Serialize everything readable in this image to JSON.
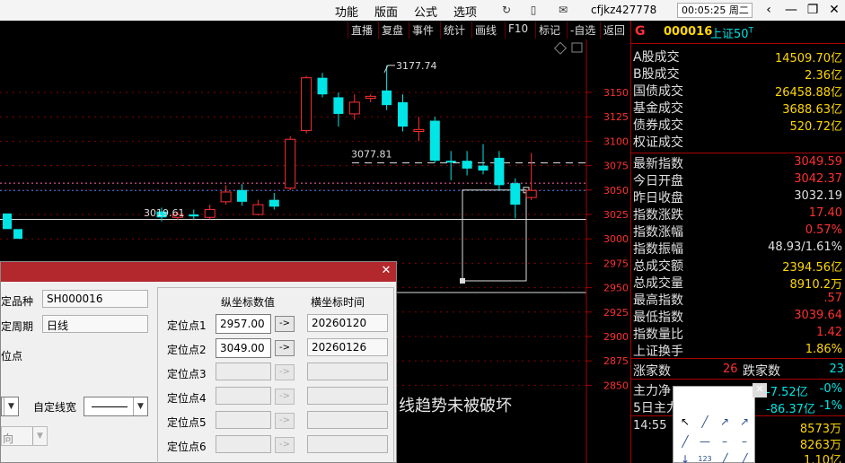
{
  "menu": {
    "items": [
      "功能",
      "版面",
      "公式",
      "选项"
    ],
    "user": "cfjkz427778",
    "clock": "00:05:25 周二"
  },
  "chart_toolbar": [
    "直播",
    "复盘",
    "事件",
    "统计",
    "画线",
    "F10",
    "标记",
    "-自选",
    "返回"
  ],
  "chart": {
    "price_labels": [
      "3150",
      "3125",
      "3100",
      "3075",
      "3050",
      "3025",
      "3000",
      "2975",
      "2950",
      "2925",
      "2900",
      "2875",
      "2850"
    ],
    "annotations": {
      "high": "3177.74",
      "mid": "3077.81",
      "low": "3019.61"
    },
    "overlay_text": "线趋势未被破坏"
  },
  "chart_data": {
    "type": "candlestick",
    "yaxis_values": [
      3150,
      3125,
      3100,
      3075,
      3050,
      3025,
      3000,
      2975,
      2950,
      2925,
      2900,
      2875,
      2850
    ],
    "candles": [
      {
        "o": 3028,
        "c": 3022,
        "h": 3032,
        "l": 3018,
        "up": false
      },
      {
        "o": 3022,
        "c": 3025,
        "h": 3028,
        "l": 3019.61,
        "up": true
      },
      {
        "o": 3025,
        "c": 3023,
        "h": 3030,
        "l": 3020,
        "up": false
      },
      {
        "o": 3022,
        "c": 3030,
        "h": 3035,
        "l": 3020,
        "up": true
      },
      {
        "o": 3038,
        "c": 3048,
        "h": 3055,
        "l": 3035,
        "up": true
      },
      {
        "o": 3050,
        "c": 3038,
        "h": 3056,
        "l": 3034,
        "up": false
      },
      {
        "o": 3025,
        "c": 3035,
        "h": 3040,
        "l": 3024,
        "up": true
      },
      {
        "o": 3040,
        "c": 3033,
        "h": 3047,
        "l": 3030,
        "up": false
      },
      {
        "o": 3052,
        "c": 3102,
        "h": 3105,
        "l": 3050,
        "up": true
      },
      {
        "o": 3111,
        "c": 3165,
        "h": 3167,
        "l": 3108,
        "up": true
      },
      {
        "o": 3165,
        "c": 3148,
        "h": 3170,
        "l": 3145,
        "up": false
      },
      {
        "o": 3145,
        "c": 3128,
        "h": 3150,
        "l": 3115,
        "up": false
      },
      {
        "o": 3128,
        "c": 3140,
        "h": 3148,
        "l": 3122,
        "up": true
      },
      {
        "o": 3144,
        "c": 3146,
        "h": 3148,
        "l": 3140,
        "up": true
      },
      {
        "o": 3152,
        "c": 3137,
        "h": 3177.74,
        "l": 3132,
        "up": false
      },
      {
        "o": 3140,
        "c": 3115,
        "h": 3148,
        "l": 3110,
        "up": false
      },
      {
        "o": 3110,
        "c": 3112,
        "h": 3125,
        "l": 3100,
        "up": true
      },
      {
        "o": 3121,
        "c": 3080,
        "h": 3125,
        "l": 3077.81,
        "up": false
      },
      {
        "o": 3080,
        "c": 3079,
        "h": 3090,
        "l": 3060,
        "up": false
      },
      {
        "o": 3080,
        "c": 3072,
        "h": 3090,
        "l": 3065,
        "up": false
      },
      {
        "o": 3075,
        "c": 3070,
        "h": 3097,
        "l": 3066,
        "up": false
      },
      {
        "o": 3083,
        "c": 3055,
        "h": 3090,
        "l": 3050,
        "up": false
      },
      {
        "o": 3057,
        "c": 3035,
        "h": 3062,
        "l": 3021,
        "up": false
      },
      {
        "o": 3042.37,
        "c": 3049.59,
        "h": 3088,
        "l": 3039.64,
        "up": true
      }
    ],
    "reference_lines": {
      "dashed_upper": 3077.81,
      "dashed_pink": 3057,
      "dashed_blue": 3049.59,
      "white_lines": [
        3020,
        2945
      ]
    }
  },
  "quote": {
    "flag": "G",
    "code": "000016",
    "name": "上证50",
    "sup": "T",
    "rows1": [
      {
        "label": "A股成交",
        "value": "14509.70亿",
        "color": "#ffd700"
      },
      {
        "label": "B股成交",
        "value": "2.36亿",
        "color": "#ffd700"
      },
      {
        "label": "国债成交",
        "value": "26458.88亿",
        "color": "#ffd700"
      },
      {
        "label": "基金成交",
        "value": "3688.63亿",
        "color": "#ffd700"
      },
      {
        "label": "债券成交",
        "value": "520.72亿",
        "color": "#ffd700"
      },
      {
        "label": "权证成交",
        "value": "",
        "color": "#ffd700"
      }
    ],
    "rows2": [
      {
        "label": "最新指数",
        "value": "3049.59",
        "color": "#ff3030"
      },
      {
        "label": "今日开盘",
        "value": "3042.37",
        "color": "#ff3030"
      },
      {
        "label": "昨日收盘",
        "value": "3032.19",
        "color": "#e0e0e0"
      },
      {
        "label": "指数涨跌",
        "value": "17.40",
        "color": "#ff3030"
      },
      {
        "label": "指数涨幅",
        "value": "0.57%",
        "color": "#ff3030"
      },
      {
        "label": "指数振幅",
        "value": "48.93/1.61%",
        "color": "#e0e0e0"
      },
      {
        "label": "总成交额",
        "value": "2394.56亿",
        "color": "#ffd700"
      },
      {
        "label": "总成交量",
        "value": "8910.2万",
        "color": "#ffd700"
      },
      {
        "label": "最高指数",
        "value": ".57",
        "color": "#ff3030"
      },
      {
        "label": "最低指数",
        "value": "3039.64",
        "color": "#ff3030"
      },
      {
        "label": "指数量比",
        "value": "1.42",
        "color": "#ff3030"
      },
      {
        "label": "上证换手",
        "value": "1.86%",
        "color": "#ffd700"
      }
    ],
    "updown": {
      "up_label": "涨家数",
      "up": "26",
      "down_label": "跌家数",
      "down": "23"
    },
    "flow": [
      {
        "label": "主力净",
        "value": "-7.52亿",
        "pct": "-0%"
      },
      {
        "label": "5日主力",
        "value": "-86.37亿",
        "pct": "-1%"
      }
    ],
    "time": "14:55",
    "vols": [
      "8573万",
      "8263万",
      "1.10亿"
    ]
  },
  "dialog": {
    "label_symbol": "定品种",
    "symbol": "SH000016",
    "label_period": "定周期",
    "period": "日线",
    "label_points": "位点",
    "label_width": "自定线宽",
    "label_dir": "向",
    "col_y": "纵坐标数值",
    "col_x": "横坐标时间",
    "points": [
      {
        "label": "定位点1",
        "y": "2957.00",
        "x": "20260120",
        "enabled": true
      },
      {
        "label": "定位点2",
        "y": "3049.00",
        "x": "20260126",
        "enabled": true
      },
      {
        "label": "定位点3",
        "y": "",
        "x": "",
        "enabled": false
      },
      {
        "label": "定位点4",
        "y": "",
        "x": "",
        "enabled": false
      },
      {
        "label": "定位点5",
        "y": "",
        "x": "",
        "enabled": false
      },
      {
        "label": "定位点6",
        "y": "",
        "x": "",
        "enabled": false
      }
    ],
    "arrow": "->"
  },
  "colors": {
    "up": "#ff3030",
    "down": "#00e5e5",
    "axis": "#a00000",
    "bg": "#000000"
  }
}
